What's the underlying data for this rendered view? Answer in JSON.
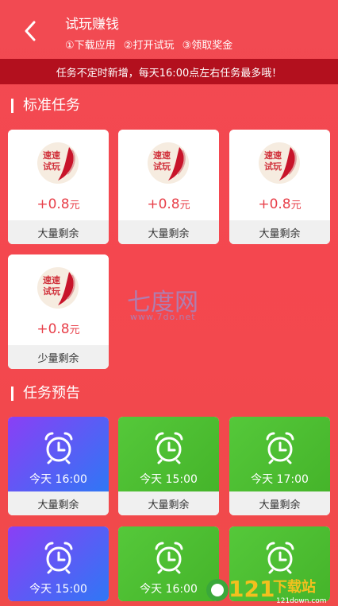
{
  "header": {
    "title": "试玩赚钱",
    "steps": [
      "①下载应用",
      "②打开试玩",
      "③领取奖金"
    ]
  },
  "notice": "任务不定时新增，每天16:00点左右任务最多哦！",
  "sections": {
    "standard": "标准任务",
    "preview": "任务预告"
  },
  "tasks": [
    {
      "reward": "+0.8",
      "unit": "元",
      "status": "大量剩余",
      "logo_text1": "速速",
      "logo_text2": "试玩"
    },
    {
      "reward": "+0.8",
      "unit": "元",
      "status": "大量剩余",
      "logo_text1": "速速",
      "logo_text2": "试玩"
    },
    {
      "reward": "+0.8",
      "unit": "元",
      "status": "大量剩余",
      "logo_text1": "速速",
      "logo_text2": "试玩"
    },
    {
      "reward": "+0.8",
      "unit": "元",
      "status": "少量剩余",
      "logo_text1": "速速",
      "logo_text2": "试玩"
    }
  ],
  "previews": [
    {
      "time": "今天 16:00",
      "status": "大量剩余",
      "color": "purple"
    },
    {
      "time": "今天 15:00",
      "status": "大量剩余",
      "color": "green"
    },
    {
      "time": "今天 17:00",
      "status": "大量剩余",
      "color": "green"
    },
    {
      "time": "今天 15:00",
      "status": "",
      "color": "purple"
    },
    {
      "time": "今天 16:00",
      "status": "",
      "color": "green"
    },
    {
      "time": "",
      "status": "",
      "color": "green"
    }
  ],
  "watermark": {
    "title": "七度网",
    "url": "www.7do.net"
  },
  "brand_badge": {
    "number": "121",
    "text": "下载站",
    "url": "121down.com"
  },
  "colors": {
    "accent": "#f24a52",
    "notice_bg": "#b3101e",
    "reward": "#e8404a"
  }
}
